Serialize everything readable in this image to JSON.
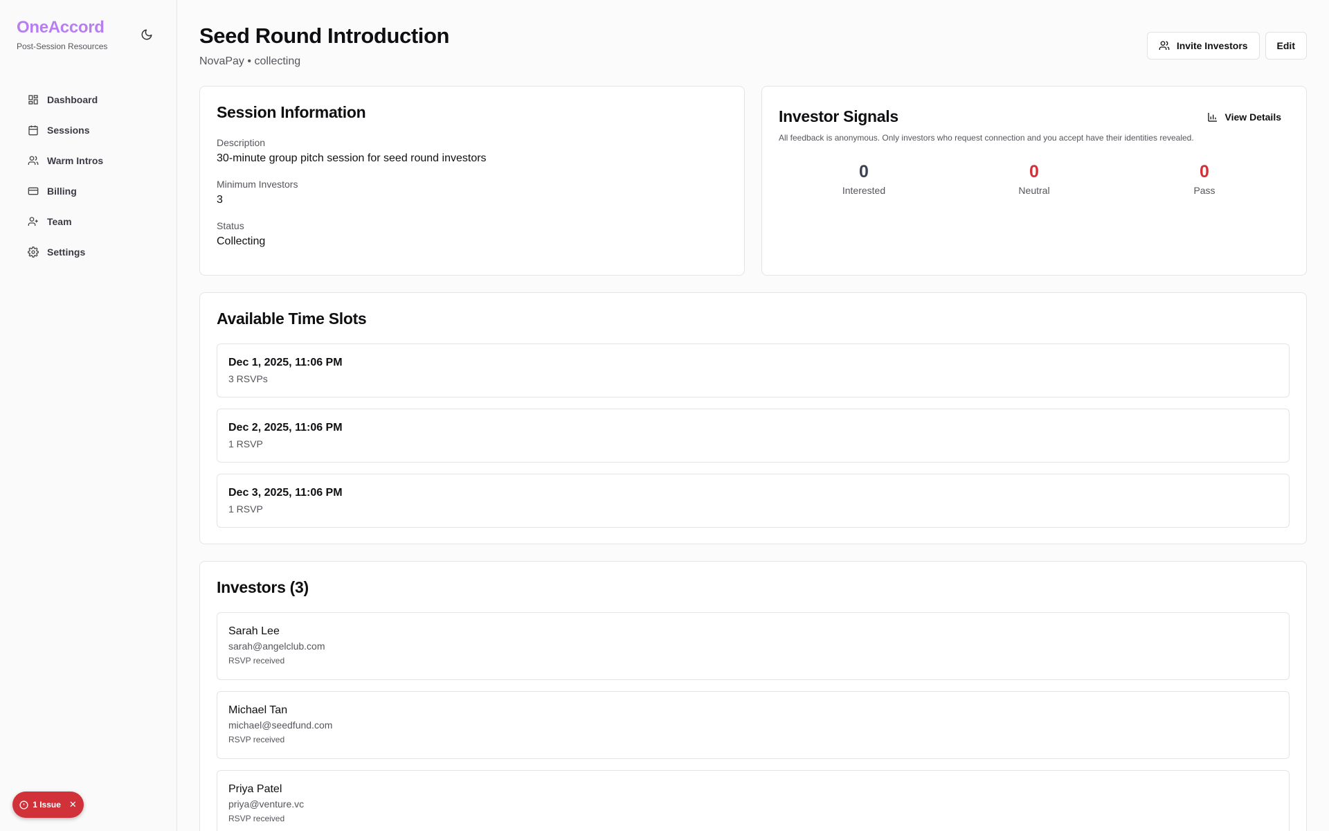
{
  "brand": {
    "name": "OneAccord",
    "subtitle": "Post-Session Resources"
  },
  "sidebar": {
    "items": [
      {
        "label": "Dashboard",
        "icon": "dashboard-icon"
      },
      {
        "label": "Sessions",
        "icon": "calendar-icon"
      },
      {
        "label": "Warm Intros",
        "icon": "users-icon"
      },
      {
        "label": "Billing",
        "icon": "credit-card-icon"
      },
      {
        "label": "Team",
        "icon": "user-plus-icon"
      },
      {
        "label": "Settings",
        "icon": "gear-icon"
      }
    ]
  },
  "issue_badge": {
    "label": "1 Issue"
  },
  "header": {
    "title": "Seed Round Introduction",
    "company": "NovaPay",
    "separator": "•",
    "status": "collecting",
    "invite_label": "Invite Investors",
    "edit_label": "Edit"
  },
  "session_info": {
    "title": "Session Information",
    "description_label": "Description",
    "description": "30-minute group pitch session for seed round investors",
    "min_investors_label": "Minimum Investors",
    "min_investors": "3",
    "status_label": "Status",
    "status": "Collecting"
  },
  "signals": {
    "title": "Investor Signals",
    "view_details_label": "View Details",
    "note": "All feedback is anonymous. Only investors who request connection and you accept have their identities revealed.",
    "stats": [
      {
        "value": "0",
        "label": "Interested",
        "color": "#3b4252"
      },
      {
        "value": "0",
        "label": "Neutral",
        "color": "#d1323a"
      },
      {
        "value": "0",
        "label": "Pass",
        "color": "#d1323a"
      }
    ]
  },
  "time_slots": {
    "title": "Available Time Slots",
    "items": [
      {
        "date": "Dec 1, 2025, 11:06 PM",
        "rsvps": "3 RSVPs"
      },
      {
        "date": "Dec 2, 2025, 11:06 PM",
        "rsvps": "1 RSVP"
      },
      {
        "date": "Dec 3, 2025, 11:06 PM",
        "rsvps": "1 RSVP"
      }
    ]
  },
  "investors": {
    "title": "Investors (3)",
    "items": [
      {
        "name": "Sarah Lee",
        "email": "sarah@angelclub.com",
        "status": "RSVP received"
      },
      {
        "name": "Michael Tan",
        "email": "michael@seedfund.com",
        "status": "RSVP received"
      },
      {
        "name": "Priya Patel",
        "email": "priya@venture.vc",
        "status": "RSVP received"
      }
    ]
  },
  "colors": {
    "brand": "#b77ef0",
    "danger": "#d1323a",
    "border": "#e4e4e8"
  }
}
